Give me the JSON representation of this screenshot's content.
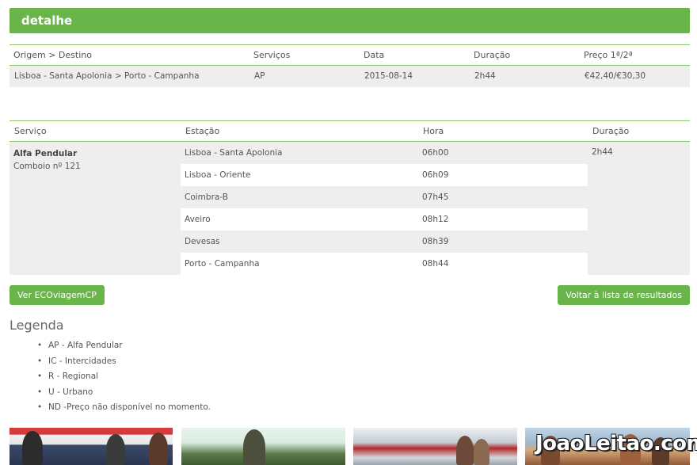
{
  "header": {
    "title": "detalhe"
  },
  "summary": {
    "columns": [
      "Origem > Destino",
      "Serviços",
      "Data",
      "Duração",
      "Preço 1ª/2ª"
    ],
    "row": {
      "route": "Lisboa - Santa Apolonia > Porto - Campanha",
      "service": "AP",
      "date": "2015-08-14",
      "duration": "2h44",
      "price": "€42,40/€30,30"
    }
  },
  "detail": {
    "columns": [
      "Serviço",
      "Estação",
      "Hora",
      "Duração"
    ],
    "service_name": "Alfa Pendular",
    "train": "Comboio nº 121",
    "duration": "2h44",
    "stops": [
      {
        "station": "Lisboa - Santa Apolonia",
        "time": "06h00"
      },
      {
        "station": "Lisboa - Oriente",
        "time": "06h09"
      },
      {
        "station": "Coimbra-B",
        "time": "07h45"
      },
      {
        "station": "Aveiro",
        "time": "08h12"
      },
      {
        "station": "Devesas",
        "time": "08h39"
      },
      {
        "station": "Porto - Campanha",
        "time": "08h44"
      }
    ]
  },
  "buttons": {
    "eco": "Ver ECOviagemCP",
    "back": "Voltar à lista de resultados"
  },
  "legend": {
    "title": "Legenda",
    "items": [
      "AP - Alfa Pendular",
      "IC - Intercidades",
      "R - Regional",
      "U - Urbano",
      "ND -Preço não disponível no momento."
    ]
  },
  "watermark": "JoaoLeitao.com",
  "colors": {
    "accent": "#6ab54a",
    "row_bg": "#eeeeee",
    "rule": "#8cc96e"
  }
}
